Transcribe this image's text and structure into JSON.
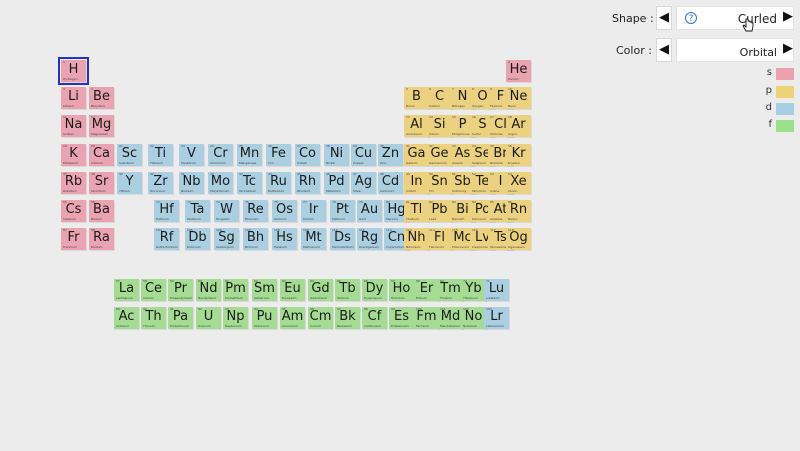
{
  "controls": {
    "shape_label": "Shape :",
    "shape_value": "Curled",
    "color_label": "Color :",
    "color_value": "Orbital",
    "prev_glyph": "◀",
    "next_glyph": "▶",
    "help_glyph": "?"
  },
  "legend": [
    {
      "label": "s",
      "color": "#eca0b0"
    },
    {
      "label": "p",
      "color": "#eed27a"
    },
    {
      "label": "d",
      "color": "#a7cfe2"
    },
    {
      "label": "f",
      "color": "#9be08a"
    }
  ],
  "block_colors": {
    "s": "#eaa3b1",
    "p": "#ecd27f",
    "d": "#a9cfe0",
    "f": "#a4dc93"
  },
  "selected_element": "H",
  "elements": [
    {
      "n": 1,
      "sym": "H",
      "name": "Hydrogen",
      "b": "s",
      "r": 1,
      "c": 1
    },
    {
      "n": 2,
      "sym": "He",
      "name": "Helium",
      "b": "s",
      "r": 1,
      "c": 18
    },
    {
      "n": 3,
      "sym": "Li",
      "name": "Lithium",
      "b": "s",
      "r": 2,
      "c": 1
    },
    {
      "n": 4,
      "sym": "Be",
      "name": "Beryllium",
      "b": "s",
      "r": 2,
      "c": 2
    },
    {
      "n": 5,
      "sym": "B",
      "name": "Boron",
      "b": "p",
      "r": 2,
      "c": 13
    },
    {
      "n": 6,
      "sym": "C",
      "name": "Carbon",
      "b": "p",
      "r": 2,
      "c": 14
    },
    {
      "n": 7,
      "sym": "N",
      "name": "Nitrogen",
      "b": "p",
      "r": 2,
      "c": 15
    },
    {
      "n": 8,
      "sym": "O",
      "name": "Oxygen",
      "b": "p",
      "r": 2,
      "c": 16
    },
    {
      "n": 9,
      "sym": "F",
      "name": "Fluorine",
      "b": "p",
      "r": 2,
      "c": 17
    },
    {
      "n": 10,
      "sym": "Ne",
      "name": "Neon",
      "b": "p",
      "r": 2,
      "c": 18
    },
    {
      "n": 11,
      "sym": "Na",
      "name": "Sodium",
      "b": "s",
      "r": 3,
      "c": 1
    },
    {
      "n": 12,
      "sym": "Mg",
      "name": "Magnesium",
      "b": "s",
      "r": 3,
      "c": 2
    },
    {
      "n": 13,
      "sym": "Al",
      "name": "Aluminium",
      "b": "p",
      "r": 3,
      "c": 13
    },
    {
      "n": 14,
      "sym": "Si",
      "name": "Silicon",
      "b": "p",
      "r": 3,
      "c": 14
    },
    {
      "n": 15,
      "sym": "P",
      "name": "Phosphorus",
      "b": "p",
      "r": 3,
      "c": 15
    },
    {
      "n": 16,
      "sym": "S",
      "name": "Sulfur",
      "b": "p",
      "r": 3,
      "c": 16
    },
    {
      "n": 17,
      "sym": "Cl",
      "name": "Chlorine",
      "b": "p",
      "r": 3,
      "c": 17
    },
    {
      "n": 18,
      "sym": "Ar",
      "name": "Argon",
      "b": "p",
      "r": 3,
      "c": 18
    },
    {
      "n": 19,
      "sym": "K",
      "name": "Potassium",
      "b": "s",
      "r": 4,
      "c": 1
    },
    {
      "n": 20,
      "sym": "Ca",
      "name": "Calcium",
      "b": "s",
      "r": 4,
      "c": 2
    },
    {
      "n": 21,
      "sym": "Sc",
      "name": "Scandium",
      "b": "d",
      "r": 4,
      "c": 3
    },
    {
      "n": 22,
      "sym": "Ti",
      "name": "Titanium",
      "b": "d",
      "r": 4,
      "c": 4
    },
    {
      "n": 23,
      "sym": "V",
      "name": "Vanadium",
      "b": "d",
      "r": 4,
      "c": 5
    },
    {
      "n": 24,
      "sym": "Cr",
      "name": "Chromium",
      "b": "d",
      "r": 4,
      "c": 6
    },
    {
      "n": 25,
      "sym": "Mn",
      "name": "Manganese",
      "b": "d",
      "r": 4,
      "c": 7
    },
    {
      "n": 26,
      "sym": "Fe",
      "name": "Iron",
      "b": "d",
      "r": 4,
      "c": 8
    },
    {
      "n": 27,
      "sym": "Co",
      "name": "Cobalt",
      "b": "d",
      "r": 4,
      "c": 9
    },
    {
      "n": 28,
      "sym": "Ni",
      "name": "Nickel",
      "b": "d",
      "r": 4,
      "c": 10
    },
    {
      "n": 29,
      "sym": "Cu",
      "name": "Copper",
      "b": "d",
      "r": 4,
      "c": 11
    },
    {
      "n": 30,
      "sym": "Zn",
      "name": "Zinc",
      "b": "d",
      "r": 4,
      "c": 12
    },
    {
      "n": 31,
      "sym": "Ga",
      "name": "Gallium",
      "b": "p",
      "r": 4,
      "c": 13
    },
    {
      "n": 32,
      "sym": "Ge",
      "name": "Germanium",
      "b": "p",
      "r": 4,
      "c": 14
    },
    {
      "n": 33,
      "sym": "As",
      "name": "Arsenic",
      "b": "p",
      "r": 4,
      "c": 15
    },
    {
      "n": 34,
      "sym": "Se",
      "name": "Selenium",
      "b": "p",
      "r": 4,
      "c": 16
    },
    {
      "n": 35,
      "sym": "Br",
      "name": "Bromine",
      "b": "p",
      "r": 4,
      "c": 17
    },
    {
      "n": 36,
      "sym": "Kr",
      "name": "Krypton",
      "b": "p",
      "r": 4,
      "c": 18
    },
    {
      "n": 37,
      "sym": "Rb",
      "name": "Rubidium",
      "b": "s",
      "r": 5,
      "c": 1
    },
    {
      "n": 38,
      "sym": "Sr",
      "name": "Strontium",
      "b": "s",
      "r": 5,
      "c": 2
    },
    {
      "n": 39,
      "sym": "Y",
      "name": "Yttrium",
      "b": "d",
      "r": 5,
      "c": 3
    },
    {
      "n": 40,
      "sym": "Zr",
      "name": "Zirconium",
      "b": "d",
      "r": 5,
      "c": 4
    },
    {
      "n": 41,
      "sym": "Nb",
      "name": "Niobium",
      "b": "d",
      "r": 5,
      "c": 5
    },
    {
      "n": 42,
      "sym": "Mo",
      "name": "Molybdenum",
      "b": "d",
      "r": 5,
      "c": 6
    },
    {
      "n": 43,
      "sym": "Tc",
      "name": "Technetium",
      "b": "d",
      "r": 5,
      "c": 7
    },
    {
      "n": 44,
      "sym": "Ru",
      "name": "Ruthenium",
      "b": "d",
      "r": 5,
      "c": 8
    },
    {
      "n": 45,
      "sym": "Rh",
      "name": "Rhodium",
      "b": "d",
      "r": 5,
      "c": 9
    },
    {
      "n": 46,
      "sym": "Pd",
      "name": "Palladium",
      "b": "d",
      "r": 5,
      "c": 10
    },
    {
      "n": 47,
      "sym": "Ag",
      "name": "Silver",
      "b": "d",
      "r": 5,
      "c": 11
    },
    {
      "n": 48,
      "sym": "Cd",
      "name": "Cadmium",
      "b": "d",
      "r": 5,
      "c": 12
    },
    {
      "n": 49,
      "sym": "In",
      "name": "Indium",
      "b": "p",
      "r": 5,
      "c": 13
    },
    {
      "n": 50,
      "sym": "Sn",
      "name": "Tin",
      "b": "p",
      "r": 5,
      "c": 14
    },
    {
      "n": 51,
      "sym": "Sb",
      "name": "Antimony",
      "b": "p",
      "r": 5,
      "c": 15
    },
    {
      "n": 52,
      "sym": "Te",
      "name": "Tellurium",
      "b": "p",
      "r": 5,
      "c": 16
    },
    {
      "n": 53,
      "sym": "I",
      "name": "Iodine",
      "b": "p",
      "r": 5,
      "c": 17
    },
    {
      "n": 54,
      "sym": "Xe",
      "name": "Xenon",
      "b": "p",
      "r": 5,
      "c": 18
    },
    {
      "n": 55,
      "sym": "Cs",
      "name": "Caesium",
      "b": "s",
      "r": 6,
      "c": 1
    },
    {
      "n": 56,
      "sym": "Ba",
      "name": "Barium",
      "b": "s",
      "r": 6,
      "c": 2
    },
    {
      "n": 72,
      "sym": "Hf",
      "name": "Hafnium",
      "b": "d",
      "r": 6,
      "c": 4
    },
    {
      "n": 73,
      "sym": "Ta",
      "name": "Tantalum",
      "b": "d",
      "r": 6,
      "c": 5
    },
    {
      "n": 74,
      "sym": "W",
      "name": "Tungsten",
      "b": "d",
      "r": 6,
      "c": 6
    },
    {
      "n": 75,
      "sym": "Re",
      "name": "Rhenium",
      "b": "d",
      "r": 6,
      "c": 7
    },
    {
      "n": 76,
      "sym": "Os",
      "name": "Osmium",
      "b": "d",
      "r": 6,
      "c": 8
    },
    {
      "n": 77,
      "sym": "Ir",
      "name": "Iridium",
      "b": "d",
      "r": 6,
      "c": 9
    },
    {
      "n": 78,
      "sym": "Pt",
      "name": "Platinum",
      "b": "d",
      "r": 6,
      "c": 10
    },
    {
      "n": 79,
      "sym": "Au",
      "name": "Gold",
      "b": "d",
      "r": 6,
      "c": 11
    },
    {
      "n": 80,
      "sym": "Hg",
      "name": "Mercury",
      "b": "d",
      "r": 6,
      "c": 12
    },
    {
      "n": 81,
      "sym": "Tl",
      "name": "Thallium",
      "b": "p",
      "r": 6,
      "c": 13
    },
    {
      "n": 82,
      "sym": "Pb",
      "name": "Lead",
      "b": "p",
      "r": 6,
      "c": 14
    },
    {
      "n": 83,
      "sym": "Bi",
      "name": "Bismuth",
      "b": "p",
      "r": 6,
      "c": 15
    },
    {
      "n": 84,
      "sym": "Po",
      "name": "Polonium",
      "b": "p",
      "r": 6,
      "c": 16
    },
    {
      "n": 85,
      "sym": "At",
      "name": "Astatine",
      "b": "p",
      "r": 6,
      "c": 17
    },
    {
      "n": 86,
      "sym": "Rn",
      "name": "Radon",
      "b": "p",
      "r": 6,
      "c": 18
    },
    {
      "n": 87,
      "sym": "Fr",
      "name": "Francium",
      "b": "s",
      "r": 7,
      "c": 1
    },
    {
      "n": 88,
      "sym": "Ra",
      "name": "Radium",
      "b": "s",
      "r": 7,
      "c": 2
    },
    {
      "n": 104,
      "sym": "Rf",
      "name": "Rutherfordium",
      "b": "d",
      "r": 7,
      "c": 4
    },
    {
      "n": 105,
      "sym": "Db",
      "name": "Dubnium",
      "b": "d",
      "r": 7,
      "c": 5
    },
    {
      "n": 106,
      "sym": "Sg",
      "name": "Seaborgium",
      "b": "d",
      "r": 7,
      "c": 6
    },
    {
      "n": 107,
      "sym": "Bh",
      "name": "Bohrium",
      "b": "d",
      "r": 7,
      "c": 7
    },
    {
      "n": 108,
      "sym": "Hs",
      "name": "Hassium",
      "b": "d",
      "r": 7,
      "c": 8
    },
    {
      "n": 109,
      "sym": "Mt",
      "name": "Meitnerium",
      "b": "d",
      "r": 7,
      "c": 9
    },
    {
      "n": 110,
      "sym": "Ds",
      "name": "Darmstadtium",
      "b": "d",
      "r": 7,
      "c": 10
    },
    {
      "n": 111,
      "sym": "Rg",
      "name": "Roentgenium",
      "b": "d",
      "r": 7,
      "c": 11
    },
    {
      "n": 112,
      "sym": "Cn",
      "name": "Copernicium",
      "b": "d",
      "r": 7,
      "c": 12
    },
    {
      "n": 113,
      "sym": "Nh",
      "name": "Nihonium",
      "b": "p",
      "r": 7,
      "c": 13
    },
    {
      "n": 114,
      "sym": "Fl",
      "name": "Flerovium",
      "b": "p",
      "r": 7,
      "c": 14
    },
    {
      "n": 115,
      "sym": "Mc",
      "name": "Moscovium",
      "b": "p",
      "r": 7,
      "c": 15
    },
    {
      "n": 116,
      "sym": "Lv",
      "name": "Livermorium",
      "b": "p",
      "r": 7,
      "c": 16
    },
    {
      "n": 117,
      "sym": "Ts",
      "name": "Tennessine",
      "b": "p",
      "r": 7,
      "c": 17
    },
    {
      "n": 118,
      "sym": "Og",
      "name": "Oganesson",
      "b": "p",
      "r": 7,
      "c": 18
    },
    {
      "n": 57,
      "sym": "La",
      "name": "Lanthanum",
      "b": "f",
      "r": 9,
      "c": 3
    },
    {
      "n": 58,
      "sym": "Ce",
      "name": "Cerium",
      "b": "f",
      "r": 9,
      "c": 4
    },
    {
      "n": 59,
      "sym": "Pr",
      "name": "Praseodymium",
      "b": "f",
      "r": 9,
      "c": 5
    },
    {
      "n": 60,
      "sym": "Nd",
      "name": "Neodymium",
      "b": "f",
      "r": 9,
      "c": 6
    },
    {
      "n": 61,
      "sym": "Pm",
      "name": "Promethium",
      "b": "f",
      "r": 9,
      "c": 7
    },
    {
      "n": 62,
      "sym": "Sm",
      "name": "Samarium",
      "b": "f",
      "r": 9,
      "c": 8
    },
    {
      "n": 63,
      "sym": "Eu",
      "name": "Europium",
      "b": "f",
      "r": 9,
      "c": 9
    },
    {
      "n": 64,
      "sym": "Gd",
      "name": "Gadolinium",
      "b": "f",
      "r": 9,
      "c": 10
    },
    {
      "n": 65,
      "sym": "Tb",
      "name": "Terbium",
      "b": "f",
      "r": 9,
      "c": 11
    },
    {
      "n": 66,
      "sym": "Dy",
      "name": "Dysprosium",
      "b": "f",
      "r": 9,
      "c": 12
    },
    {
      "n": 67,
      "sym": "Ho",
      "name": "Holmium",
      "b": "f",
      "r": 9,
      "c": 13
    },
    {
      "n": 68,
      "sym": "Er",
      "name": "Erbium",
      "b": "f",
      "r": 9,
      "c": 14
    },
    {
      "n": 69,
      "sym": "Tm",
      "name": "Thulium",
      "b": "f",
      "r": 9,
      "c": 15
    },
    {
      "n": 70,
      "sym": "Yb",
      "name": "Ytterbium",
      "b": "f",
      "r": 9,
      "c": 16
    },
    {
      "n": 71,
      "sym": "Lu",
      "name": "Lutetium",
      "b": "d",
      "r": 9,
      "c": 17
    },
    {
      "n": 89,
      "sym": "Ac",
      "name": "Actinium",
      "b": "f",
      "r": 10,
      "c": 3
    },
    {
      "n": 90,
      "sym": "Th",
      "name": "Thorium",
      "b": "f",
      "r": 10,
      "c": 4
    },
    {
      "n": 91,
      "sym": "Pa",
      "name": "Protactinium",
      "b": "f",
      "r": 10,
      "c": 5
    },
    {
      "n": 92,
      "sym": "U",
      "name": "Uranium",
      "b": "f",
      "r": 10,
      "c": 6
    },
    {
      "n": 93,
      "sym": "Np",
      "name": "Neptunium",
      "b": "f",
      "r": 10,
      "c": 7
    },
    {
      "n": 94,
      "sym": "Pu",
      "name": "Plutonium",
      "b": "f",
      "r": 10,
      "c": 8
    },
    {
      "n": 95,
      "sym": "Am",
      "name": "Americium",
      "b": "f",
      "r": 10,
      "c": 9
    },
    {
      "n": 96,
      "sym": "Cm",
      "name": "Curium",
      "b": "f",
      "r": 10,
      "c": 10
    },
    {
      "n": 97,
      "sym": "Bk",
      "name": "Berkelium",
      "b": "f",
      "r": 10,
      "c": 11
    },
    {
      "n": 98,
      "sym": "Cf",
      "name": "Californium",
      "b": "f",
      "r": 10,
      "c": 12
    },
    {
      "n": 99,
      "sym": "Es",
      "name": "Einsteinium",
      "b": "f",
      "r": 10,
      "c": 13
    },
    {
      "n": 100,
      "sym": "Fm",
      "name": "Fermium",
      "b": "f",
      "r": 10,
      "c": 14
    },
    {
      "n": 101,
      "sym": "Md",
      "name": "Mendelevium",
      "b": "f",
      "r": 10,
      "c": 15
    },
    {
      "n": 102,
      "sym": "No",
      "name": "Nobelium",
      "b": "f",
      "r": 10,
      "c": 16
    },
    {
      "n": 103,
      "sym": "Lr",
      "name": "Lawrencium",
      "b": "d",
      "r": 10,
      "c": 17
    }
  ]
}
